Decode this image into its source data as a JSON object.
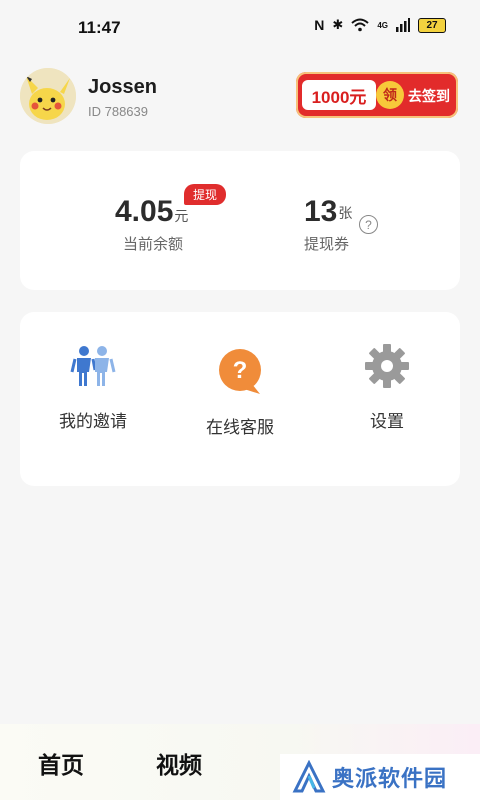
{
  "status_bar": {
    "time": "11:47",
    "signal_label": "4G",
    "battery": "27"
  },
  "profile": {
    "name": "Jossen",
    "id_text": "ID  788639",
    "signin": {
      "amount": "1000元",
      "badge": "领",
      "action": "去签到"
    }
  },
  "balance_card": {
    "balance_value": "4.05",
    "balance_unit": "元",
    "balance_label": "当前余额",
    "withdraw_badge": "提现",
    "voucher_value": "13",
    "voucher_unit": "张",
    "voucher_label": "提现券",
    "help_symbol": "?"
  },
  "menu": {
    "items": [
      {
        "label": "我的邀请",
        "icon": "people-icon"
      },
      {
        "label": "在线客服",
        "icon": "question-chat-icon"
      },
      {
        "label": "设置",
        "icon": "gear-icon"
      }
    ]
  },
  "tabbar": {
    "tabs": [
      "首页",
      "视频"
    ]
  },
  "watermark": {
    "text": "奥派软件园"
  },
  "colors": {
    "accent_red": "#e02d2d",
    "blue": "#3f78cf",
    "orange": "#f08c3a",
    "gray_gear": "#9a9a9a"
  }
}
